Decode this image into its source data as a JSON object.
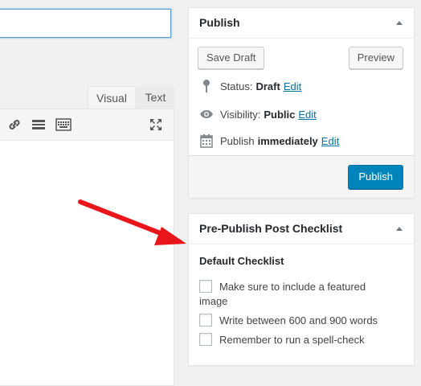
{
  "editor": {
    "tabs": [
      {
        "label": "Visual"
      },
      {
        "label": "Text"
      }
    ],
    "toolbar_icons": [
      "link-icon",
      "more-tag-icon",
      "toolbar-toggle-icon",
      "fullscreen-icon"
    ]
  },
  "publish": {
    "title": "Publish",
    "save_draft": "Save Draft",
    "preview": "Preview",
    "status_label": "Status:",
    "status_value": "Draft",
    "visibility_label": "Visibility:",
    "visibility_value": "Public",
    "publish_label": "Publish",
    "publish_value": "immediately",
    "edit": "Edit",
    "publish_button": "Publish"
  },
  "checklist": {
    "title": "Pre-Publish Post Checklist",
    "heading": "Default Checklist",
    "items": [
      {
        "label": "Make sure to include a featured image"
      },
      {
        "label": "Write between 600 and 900 words"
      },
      {
        "label": "Remember to run a spell-check"
      }
    ]
  },
  "colors": {
    "accent": "#0085ba",
    "link": "#0073aa",
    "annotation_arrow": "#e8151b"
  }
}
